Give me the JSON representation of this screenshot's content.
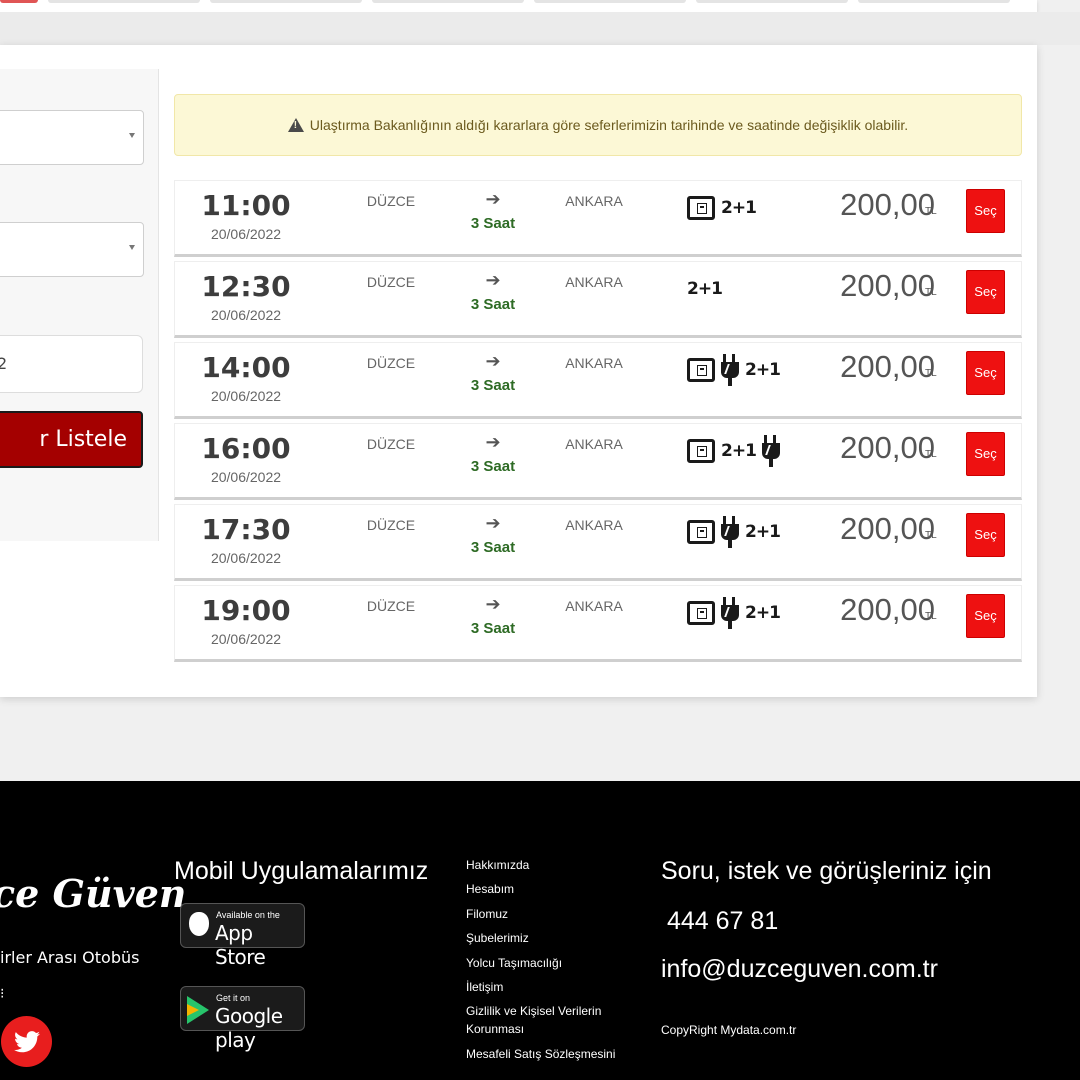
{
  "search_form": {
    "date_value_fragment": "2",
    "list_button_label": "r Listele"
  },
  "notice": {
    "text": "Ulaştırma Bakanlığının aldığı kararlara göre seferlerimizin tarihinde ve saatinde değişiklik olabilir.",
    "icon": "warning-icon"
  },
  "trips": [
    {
      "time": "11:00",
      "date": "20/06/2022",
      "from": "DÜZCE",
      "arrow": "➔",
      "duration": "3 Saat",
      "to": "ANKARA",
      "features": [
        "screen",
        "seat"
      ],
      "seat_label": "2+1",
      "price": "200,00",
      "currency": "TL",
      "select_label": "Seç"
    },
    {
      "time": "12:30",
      "date": "20/06/2022",
      "from": "DÜZCE",
      "arrow": "➔",
      "duration": "3 Saat",
      "to": "ANKARA",
      "features": [
        "seat"
      ],
      "seat_label": "2+1",
      "price": "200,00",
      "currency": "TL",
      "select_label": "Seç"
    },
    {
      "time": "14:00",
      "date": "20/06/2022",
      "from": "DÜZCE",
      "arrow": "➔",
      "duration": "3 Saat",
      "to": "ANKARA",
      "features": [
        "screen",
        "plug",
        "seat"
      ],
      "seat_label": "2+1",
      "price": "200,00",
      "currency": "TL",
      "select_label": "Seç"
    },
    {
      "time": "16:00",
      "date": "20/06/2022",
      "from": "DÜZCE",
      "arrow": "➔",
      "duration": "3 Saat",
      "to": "ANKARA",
      "features": [
        "screen",
        "seat",
        "plug"
      ],
      "seat_label": "2+1",
      "price": "200,00",
      "currency": "TL",
      "select_label": "Seç"
    },
    {
      "time": "17:30",
      "date": "20/06/2022",
      "from": "DÜZCE",
      "arrow": "➔",
      "duration": "3 Saat",
      "to": "ANKARA",
      "features": [
        "screen",
        "plug",
        "seat"
      ],
      "seat_label": "2+1",
      "price": "200,00",
      "currency": "TL",
      "select_label": "Seç"
    },
    {
      "time": "19:00",
      "date": "20/06/2022",
      "from": "DÜZCE",
      "arrow": "➔",
      "duration": "3 Saat",
      "to": "ANKARA",
      "features": [
        "screen",
        "plug",
        "seat"
      ],
      "seat_label": "2+1",
      "price": "200,00",
      "currency": "TL",
      "select_label": "Seç"
    }
  ],
  "footer": {
    "brand": "ce Güven",
    "brand_sub": "irler Arası Otobüs",
    "brand_dots": "⁝",
    "social_icon": "twitter-icon",
    "mobile_title": "Mobil Uygulamalarımız",
    "app_store": {
      "small": "Available on the",
      "big": "App Store"
    },
    "google_play": {
      "small": "Get it on",
      "big": "Google play"
    },
    "links": [
      "Hakkımızda",
      "Hesabım",
      "Filomuz",
      "Şubelerimiz",
      "Yolcu Taşımacılığı",
      "İletişim",
      "Gizlilik ve Kişisel Verilerin Korunması",
      "Mesafeli Satış Sözleşmesini"
    ],
    "contact_title": "Soru, istek ve görüşleriniz için",
    "phone": "444 67 81",
    "email": "info@duzceguven.com.tr",
    "copyright": "CopyRight Mydata.com.tr"
  },
  "colors": {
    "accent": "#ee1111",
    "list_button": "#a40000",
    "duration": "#2e6b25",
    "notice_bg": "#fcf8d6",
    "footer_bg": "#000000"
  }
}
